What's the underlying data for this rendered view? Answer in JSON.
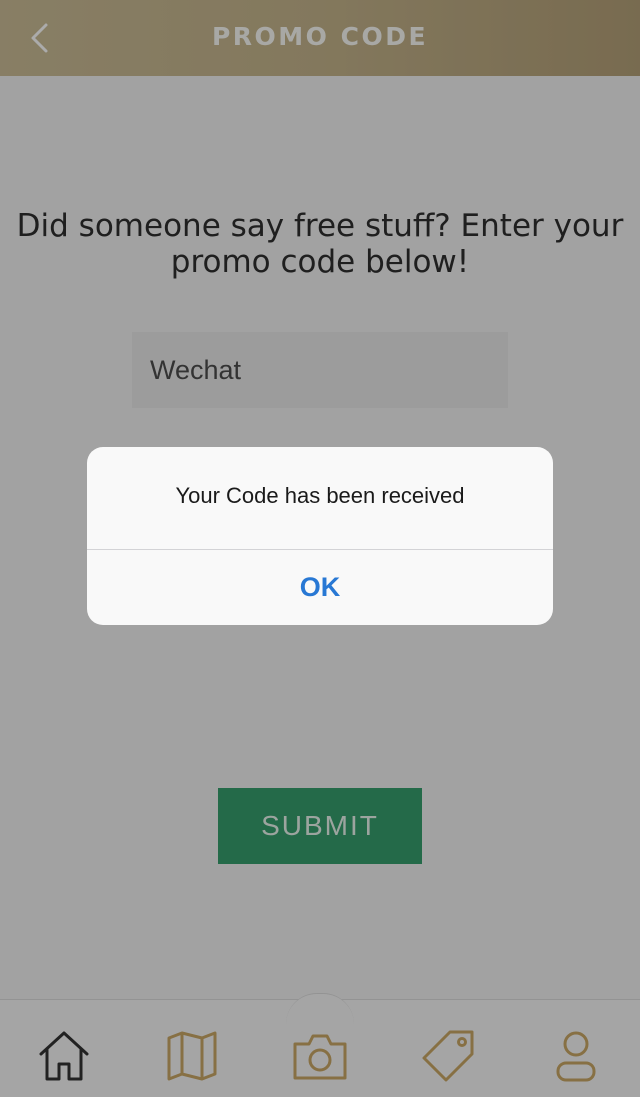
{
  "header": {
    "title": "PROMO CODE",
    "back_icon": "chevron-left-icon"
  },
  "main": {
    "prompt": "Did someone say free stuff? Enter your promo code below!",
    "promo_input": {
      "value": "Wechat"
    },
    "submit_label": "SUBMIT"
  },
  "dialog": {
    "message": "Your Code has been received",
    "ok_label": "OK"
  },
  "tabbar": {
    "items": [
      {
        "icon": "home-icon"
      },
      {
        "icon": "map-icon"
      },
      {
        "icon": "camera-icon"
      },
      {
        "icon": "tag-icon"
      },
      {
        "icon": "profile-icon"
      }
    ]
  },
  "colors": {
    "header_gradient_start": "#cbbd97",
    "header_gradient_end": "#b4a078",
    "submit_green": "#379e6d",
    "ok_blue": "#2878d4",
    "tab_gold": "#c9a866",
    "tab_active": "#333333"
  }
}
